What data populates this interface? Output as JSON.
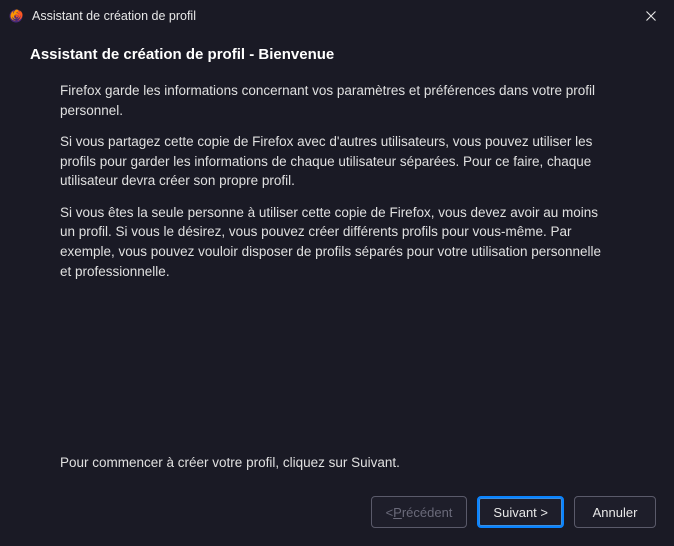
{
  "titlebar": {
    "title": "Assistant de création de profil"
  },
  "header": {
    "title": "Assistant de création de profil - Bienvenue"
  },
  "content": {
    "para1": "Firefox garde les informations concernant vos paramètres et préférences dans votre profil personnel.",
    "para2": "Si vous partagez cette copie de Firefox avec d'autres utilisateurs, vous pouvez utiliser les profils pour garder les informations de chaque utilisateur séparées. Pour ce faire, chaque utilisateur devra créer son propre profil.",
    "para3": "Si vous êtes la seule personne à utiliser cette copie de Firefox, vous devez avoir au moins un profil. Si vous le désirez, vous pouvez créer différents profils pour vous-même. Par exemple, vous pouvez vouloir disposer de profils séparés pour votre utilisation personnelle et professionnelle."
  },
  "footer": {
    "instruction": "Pour commencer à créer votre profil, cliquez sur Suivant."
  },
  "buttons": {
    "back_prefix": "< ",
    "back_underline": "P",
    "back_suffix": "récédent",
    "next": "Suivant >",
    "cancel": "Annuler"
  }
}
